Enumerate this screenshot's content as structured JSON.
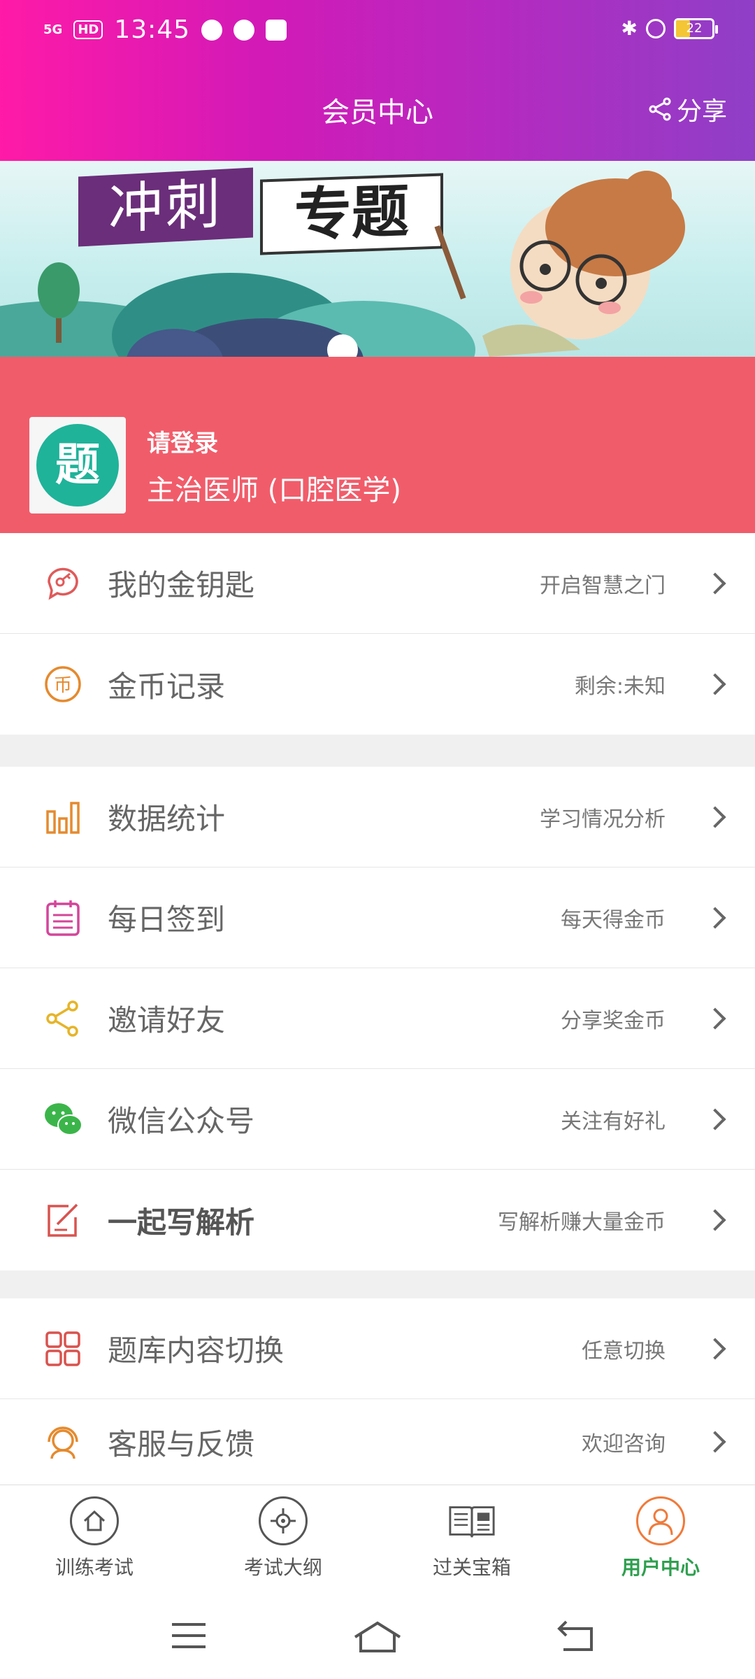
{
  "status_bar": {
    "signal": "5G",
    "hd": "HD",
    "time": "13:45",
    "battery": "22"
  },
  "header": {
    "title": "会员中心",
    "share_label": "分享"
  },
  "banner": {
    "text_part1": "冲刺",
    "text_part2": "专题"
  },
  "profile": {
    "avatar_char": "题",
    "login_prompt": "请登录",
    "subject": "主治医师 (口腔医学)"
  },
  "menu_group1": [
    {
      "label": "我的金钥匙",
      "hint": "开启智慧之门",
      "icon": "key-chat-icon",
      "color": "#e05a5a"
    },
    {
      "label": "金币记录",
      "hint": "剩余:未知",
      "icon": "coin-icon",
      "color": "#e58a2e"
    }
  ],
  "menu_group2": [
    {
      "label": "数据统计",
      "hint": "学习情况分析",
      "icon": "bar-chart-icon",
      "color": "#e58a2e"
    },
    {
      "label": "每日签到",
      "hint": "每天得金币",
      "icon": "calendar-icon",
      "color": "#d4459a"
    },
    {
      "label": "邀请好友",
      "hint": "分享奖金币",
      "icon": "share-nodes-icon",
      "color": "#e6b428"
    },
    {
      "label": "微信公众号",
      "hint": "关注有好礼",
      "icon": "wechat-icon",
      "color": "#3bb54a"
    },
    {
      "label": "一起写解析",
      "hint": "写解析赚大量金币",
      "icon": "edit-icon",
      "color": "#d9534f",
      "bold": true
    }
  ],
  "menu_group3": [
    {
      "label": "题库内容切换",
      "hint": "任意切换",
      "icon": "grid-icon",
      "color": "#d9534f"
    },
    {
      "label": "客服与反馈",
      "hint": "欢迎咨询",
      "icon": "support-icon",
      "color": "#e58a2e"
    }
  ],
  "tabbar": [
    {
      "label": "训练考试",
      "icon": "home-icon"
    },
    {
      "label": "考试大纲",
      "icon": "target-icon"
    },
    {
      "label": "过关宝箱",
      "icon": "book-icon"
    },
    {
      "label": "用户中心",
      "icon": "user-icon",
      "active": true
    }
  ]
}
